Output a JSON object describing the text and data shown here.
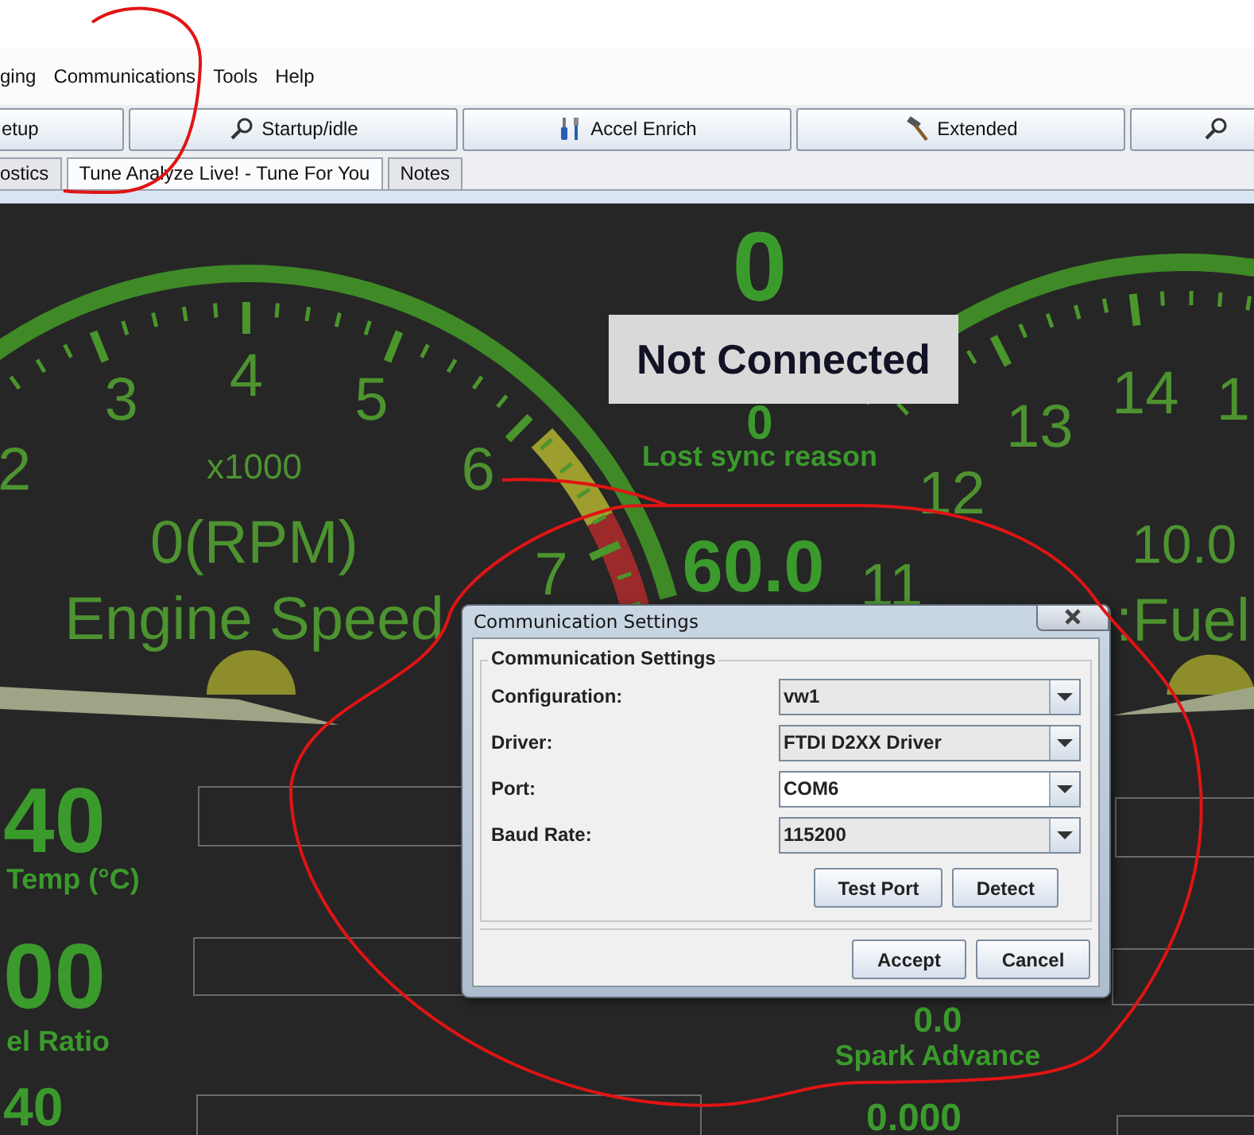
{
  "menu_bar": {
    "items": [
      "ging",
      "Communications",
      "Tools",
      "Help"
    ]
  },
  "toolbar": {
    "buttons": [
      "etup",
      "Startup/idle",
      "Accel Enrich",
      "Extended"
    ]
  },
  "tabs": [
    {
      "label": "ostics",
      "selected": false
    },
    {
      "label": "Tune Analyze Live! - Tune For You",
      "selected": true
    },
    {
      "label": "Notes",
      "selected": false
    }
  ],
  "dashboard": {
    "rpm_gauge": {
      "scale_labels": [
        "2",
        "3",
        "4",
        "5",
        "6",
        "7"
      ],
      "multiplier": "x1000",
      "reading": "0(RPM)",
      "title": "Engine Speed"
    },
    "afr_gauge": {
      "scale_labels": [
        "11",
        "12",
        "13",
        "14",
        "1"
      ],
      "reading": "10.0",
      "title": ":Fuel"
    },
    "status_overlay": "Not Connected",
    "readouts": [
      {
        "value": "0"
      },
      {
        "value": "0",
        "label": "Lost sync reason"
      },
      {
        "value": "60.0"
      },
      {
        "value": "40",
        "label": "Temp (°C)"
      },
      {
        "value": "00",
        "label": "el Ratio"
      },
      {
        "value": "40"
      },
      {
        "value": "0.0",
        "label": "Spark Advance"
      },
      {
        "value": "0.000"
      }
    ]
  },
  "dialog": {
    "title": "Communication Settings",
    "group_title": "Communication Settings",
    "fields": [
      {
        "label": "Configuration:",
        "value": "vw1",
        "editable": false
      },
      {
        "label": "Driver:",
        "value": "FTDI D2XX Driver",
        "editable": false
      },
      {
        "label": "Port:",
        "value": "COM6",
        "editable": true
      },
      {
        "label": "Baud Rate:",
        "value": "115200",
        "editable": false
      }
    ],
    "buttons": [
      "Test Port",
      "Detect"
    ],
    "footer_buttons": [
      "Accept",
      "Cancel"
    ]
  }
}
